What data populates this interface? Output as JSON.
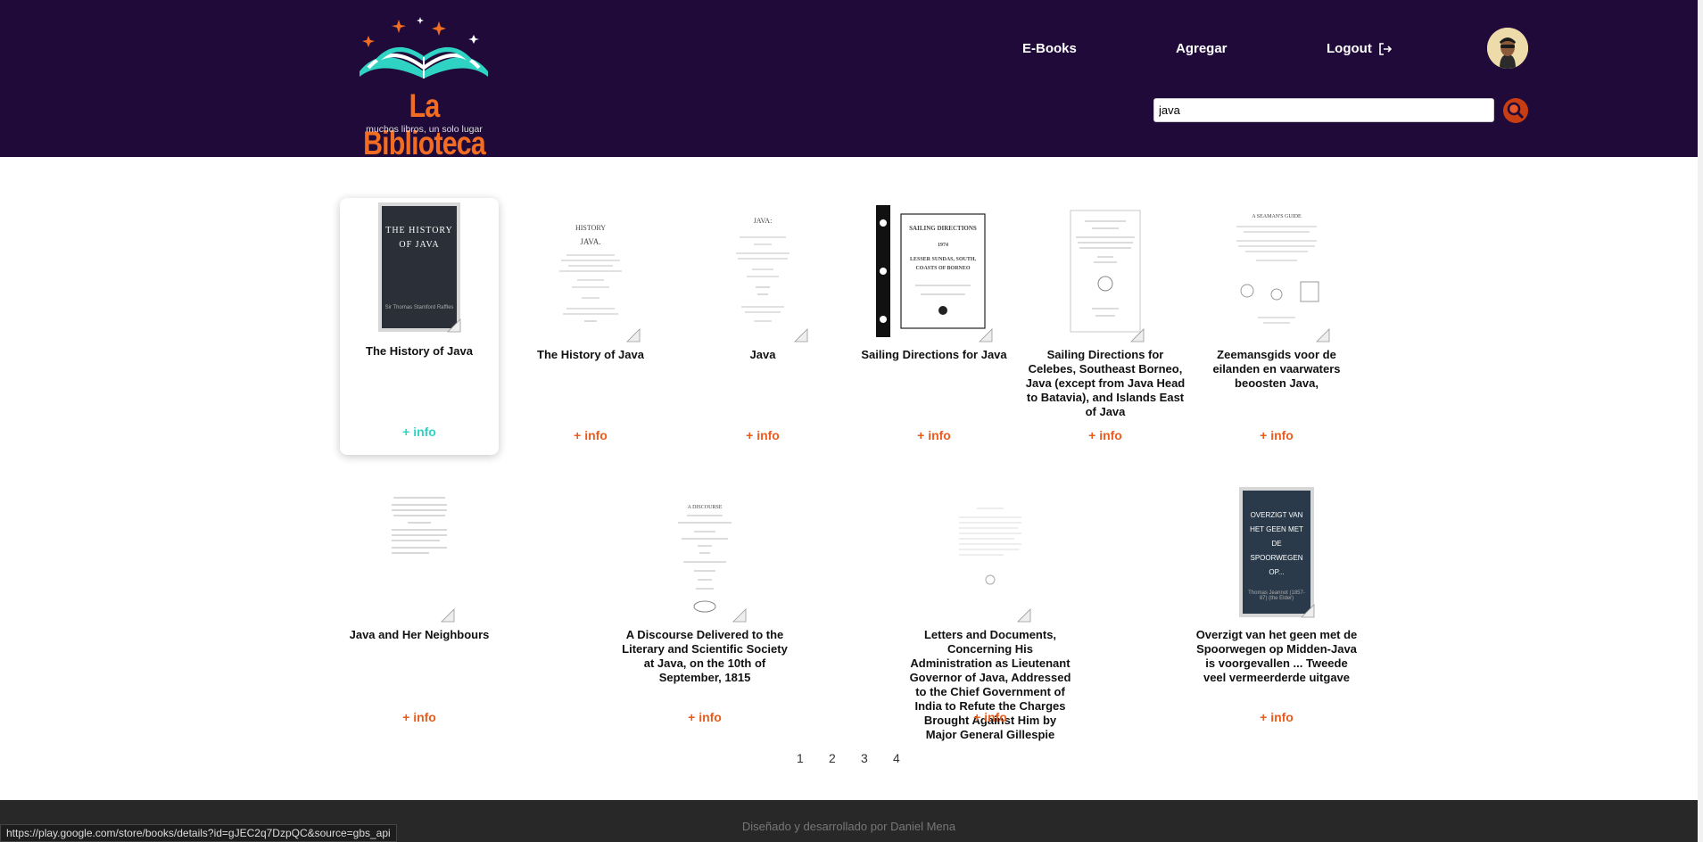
{
  "brand": {
    "title": "La Biblioteca",
    "tagline": "muchos libros, un solo lugar"
  },
  "nav": {
    "ebooks": "E-Books",
    "add": "Agregar",
    "logout": "Logout"
  },
  "search": {
    "value": "java",
    "placeholder": ""
  },
  "books": [
    {
      "title": "The History of Java",
      "info": "+ info",
      "cover_text": "THE HISTORY OF JAVA",
      "cover_author": "Sir Thomas Stamford Raffles"
    },
    {
      "title": "The History of Java",
      "info": "+ info"
    },
    {
      "title": "Java",
      "info": "+ info"
    },
    {
      "title": "Sailing Directions for Java",
      "info": "+ info"
    },
    {
      "title": "Sailing Directions for Celebes, Southeast Borneo, Java (except from Java Head to Batavia), and Islands East of Java",
      "info": "+ info"
    },
    {
      "title": "Zeemansgids voor de eilanden en vaarwaters beoosten Java,",
      "info": "+ info"
    },
    {
      "title": "Java and Her Neighbours",
      "info": "+ info"
    },
    {
      "title": "A Discourse Delivered to the Literary and Scientific Society at Java, on the 10th of September, 1815",
      "info": "+ info"
    },
    {
      "title": "Letters and Documents, Concerning His Administration as Lieutenant Governor of Java, Addressed to the Chief Government of India to Refute the Charges Brought Against Him by Major General Gillespie",
      "info": "+ info"
    },
    {
      "title": "Overzigt van het geen met de Spoorwegen op Midden-Java is voorgevallen ... Tweede veel vermeerderde uitgave",
      "info": "+ info",
      "cover_text": "OVERZIGT VAN HET GEEN MET DE SPOORWEGEN OP...",
      "cover_author": "Thomas Jeannot (1857-87) (the Elder)"
    }
  ],
  "pagination": [
    "1",
    "2",
    "3",
    "4"
  ],
  "footer": {
    "text": "Diseñado y desarrollado por Daniel Mena"
  },
  "status_url": "https://play.google.com/store/books/details?id=gJEC2q7DzpQC&source=gbs_api",
  "colors": {
    "header": "#1f0a3a",
    "accent": "#e85d1f",
    "active_info": "#2fd3c4",
    "footer": "#282828"
  }
}
